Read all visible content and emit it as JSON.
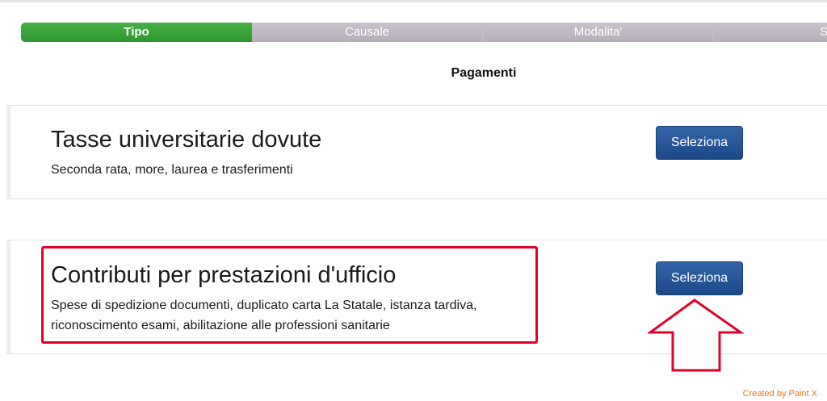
{
  "steps": [
    {
      "label": "Tipo",
      "active": true
    },
    {
      "label": "Causale",
      "active": false
    },
    {
      "label": "Modalita'",
      "active": false
    },
    {
      "label": "Sta",
      "active": false
    }
  ],
  "page_title": "Pagamenti",
  "cards": [
    {
      "title": "Tasse universitarie dovute",
      "description": "Seconda rata, more, laurea e trasferimenti",
      "button_label": "Seleziona"
    },
    {
      "title": "Contributi per prestazioni d'ufficio",
      "description": "Spese di spedizione documenti, duplicato carta La Statale, istanza tardiva, riconoscimento esami, abilitazione alle professioni sanitarie",
      "button_label": "Seleziona"
    }
  ],
  "annotation": {
    "highlight_color": "#e0002a",
    "arrow_icon": "up-arrow-outline-icon"
  },
  "watermark": "Created by Paint X",
  "colors": {
    "active_step": "#3aa33a",
    "inactive_step": "#bfb8c4",
    "button": "#2a5599"
  }
}
